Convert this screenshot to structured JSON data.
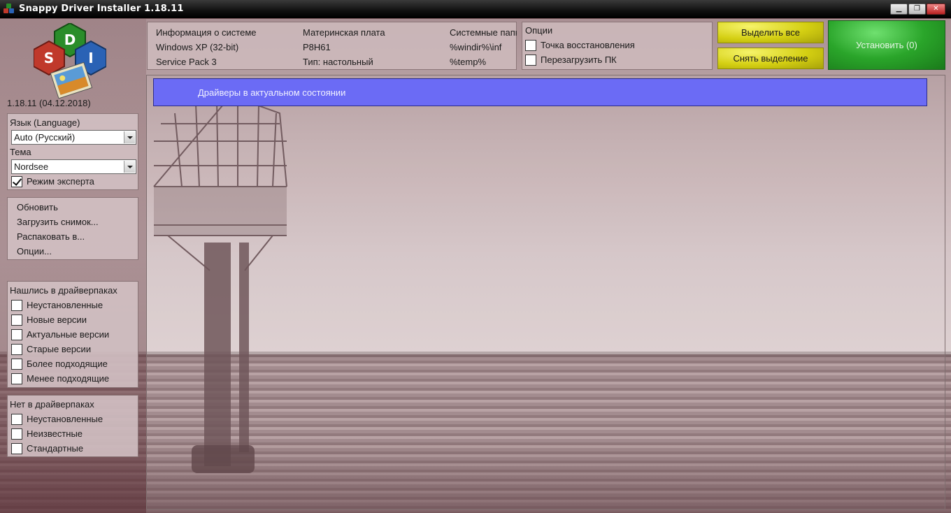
{
  "window": {
    "title": "Snappy Driver Installer 1.18.11",
    "minimize_glyph": "▁",
    "maximize_glyph": "❐",
    "close_glyph": "✕"
  },
  "logo": {
    "letters": [
      "D",
      "S",
      "I"
    ],
    "colors": [
      "#2a8d2a",
      "#c0392b",
      "#2a62b5"
    ]
  },
  "version": "1.18.11 (04.12.2018)",
  "language_panel": {
    "language_label": "Язык (Language)",
    "language_value": "Auto (Русский)",
    "theme_label": "Тема",
    "theme_value": "Nordsee",
    "expert_mode_label": "Режим эксперта",
    "expert_mode_checked": true
  },
  "actions": [
    "Обновить",
    "Загрузить снимок...",
    "Распаковать в...",
    "Опции..."
  ],
  "found_in_driverpacks": {
    "title": "Нашлись в драйверпаках",
    "items": [
      "Неустановленные",
      "Новые версии",
      "Актуальные версии",
      "Старые версии",
      "Более подходящие",
      "Менее подходящие"
    ]
  },
  "not_in_driverpacks": {
    "title": "Нет в драйверпаках",
    "items": [
      "Неустановленные",
      "Неизвестные",
      "Стандартные"
    ]
  },
  "system_info": {
    "col1": [
      "Информация о системе",
      "Windows XP (32-bit)",
      "Service Pack 3"
    ],
    "col2": [
      "Материнская плата",
      "P8H61",
      "Тип: настольный"
    ],
    "col3": [
      "Системные папки",
      "%windir%\\inf",
      "%temp%"
    ]
  },
  "options_panel": {
    "title": "Опции",
    "restore_point_label": "Точка восстановления",
    "reboot_label": "Перезагрузить ПК"
  },
  "buttons": {
    "select_all": "Выделить все",
    "deselect_all": "Снять выделение",
    "install": "Установить (0)"
  },
  "status": "Драйверы в актуальном состоянии",
  "colors": {
    "status_bar": "#6b6bf5",
    "select_buttons": "#d4cf12",
    "install_button": "#2aa52a"
  }
}
